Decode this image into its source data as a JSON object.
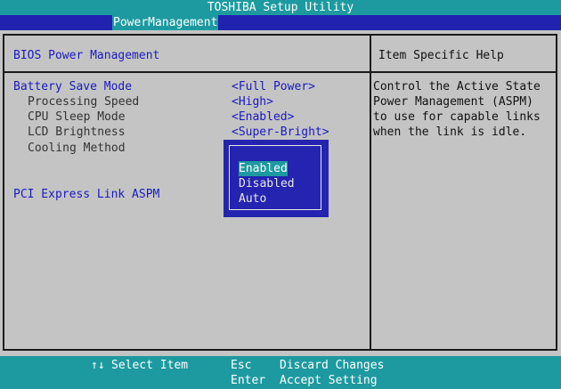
{
  "title": "TOSHIBA Setup Utility",
  "menu": {
    "active_tab": "PowerManagement"
  },
  "section": {
    "title": "BIOS Power Management"
  },
  "settings": [
    {
      "label": "Battery Save Mode",
      "value": "<Full Power>"
    },
    {
      "label": "Processing Speed",
      "value": "<High>"
    },
    {
      "label": "CPU Sleep Mode",
      "value": "<Enabled>"
    },
    {
      "label": "LCD Brightness",
      "value": "<Super-Bright>"
    },
    {
      "label": "Cooling Method"
    },
    {
      "label": "PCI Express Link ASPM"
    }
  ],
  "popup": {
    "options": [
      "Enabled",
      "Disabled",
      "Auto"
    ],
    "selected": "Enabled"
  },
  "help": {
    "title": "Item Specific Help",
    "lines": [
      "Control the Active State",
      "Power Management (ASPM)",
      "to use for capable links",
      "when the link is idle."
    ]
  },
  "footer": {
    "nav_icon": "↑↓",
    "select": "Select Item",
    "esc_key": "Esc",
    "esc_action": "Discard Changes",
    "enter_key": "Enter",
    "enter_action": "Accept Setting"
  },
  "colors": {
    "teal": "#1d9aa0",
    "blue": "#2222b0",
    "background": "#c4c4c4",
    "text_blue": "#1a1ac0"
  }
}
